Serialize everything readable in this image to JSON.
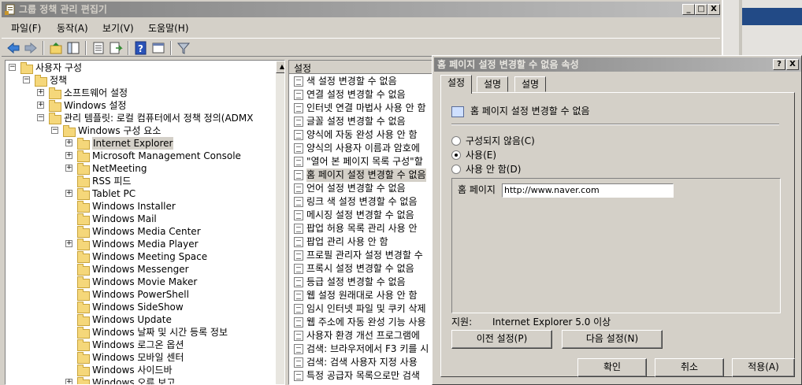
{
  "window": {
    "title": "그룹 정책 관리 편집기",
    "controls": {
      "minimize": "_",
      "maximize": "□",
      "close": "X"
    }
  },
  "menu": [
    "파일(F)",
    "동작(A)",
    "보기(V)",
    "도움말(H)"
  ],
  "toolbar": {
    "icons": [
      "back-icon",
      "forward-icon",
      "up-folder-icon",
      "show-hide-tree-icon",
      "export-list-icon",
      "properties-icon",
      "help-icon",
      "console-tree-icon",
      "filter-icon"
    ]
  },
  "tree": {
    "items": [
      {
        "label": "사용자 구성",
        "expander": "−",
        "depth": 0
      },
      {
        "label": "정책",
        "expander": "−",
        "depth": 1
      },
      {
        "label": "소프트웨어 설정",
        "expander": "+",
        "depth": 2
      },
      {
        "label": "Windows 설정",
        "expander": "+",
        "depth": 2
      },
      {
        "label": "관리 템플릿: 로컬 컴퓨터에서 정책 정의(ADMX",
        "expander": "−",
        "depth": 2
      },
      {
        "label": "Windows 구성 요소",
        "expander": "−",
        "depth": 3
      },
      {
        "label": "Internet Explorer",
        "expander": "+",
        "depth": 4,
        "selected": true
      },
      {
        "label": "Microsoft Management Console",
        "expander": "+",
        "depth": 4
      },
      {
        "label": "NetMeeting",
        "expander": "+",
        "depth": 4
      },
      {
        "label": "RSS 피드",
        "expander": "",
        "depth": 4
      },
      {
        "label": "Tablet PC",
        "expander": "+",
        "depth": 4
      },
      {
        "label": "Windows Installer",
        "expander": "",
        "depth": 4
      },
      {
        "label": "Windows Mail",
        "expander": "",
        "depth": 4
      },
      {
        "label": "Windows Media Center",
        "expander": "",
        "depth": 4
      },
      {
        "label": "Windows Media Player",
        "expander": "+",
        "depth": 4
      },
      {
        "label": "Windows Meeting Space",
        "expander": "",
        "depth": 4
      },
      {
        "label": "Windows Messenger",
        "expander": "",
        "depth": 4
      },
      {
        "label": "Windows Movie Maker",
        "expander": "",
        "depth": 4
      },
      {
        "label": "Windows PowerShell",
        "expander": "",
        "depth": 4
      },
      {
        "label": "Windows SideShow",
        "expander": "",
        "depth": 4
      },
      {
        "label": "Windows Update",
        "expander": "",
        "depth": 4
      },
      {
        "label": "Windows 날짜 및 시간 등록 정보",
        "expander": "",
        "depth": 4
      },
      {
        "label": "Windows 로그온 옵션",
        "expander": "",
        "depth": 4
      },
      {
        "label": "Windows 모바일 센터",
        "expander": "",
        "depth": 4
      },
      {
        "label": "Windows 사이드바",
        "expander": "",
        "depth": 4
      },
      {
        "label": "Windows 오류 보고",
        "expander": "+",
        "depth": 4
      }
    ]
  },
  "list": {
    "header": "설정",
    "items": [
      "색 설정 변경할 수 없음",
      "연결 설정 변경할 수 없음",
      "인터넷 연결 마법사 사용 안 함",
      "글꼴 설정 변경할 수 없음",
      "양식에 자동 완성 사용 안 함",
      "양식의 사용자 이름과 암호에",
      "\"열어 본 페이지 목록 구성\"할",
      "홈 페이지 설정 변경할 수 없음",
      "언어 설정 변경할 수 없음",
      "링크 색 설정 변경할 수 없음",
      "메시징 설정 변경할 수 없음",
      "팝업 허용 목록 관리 사용 안",
      "팝업 관리 사용 안 함",
      "프로필 관리자 설정 변경할 수",
      "프록시 설정 변경할 수 없음",
      "등급 설정 변경할 수 없음",
      "웹 설정 원래대로 사용 안 함",
      "임시 인터넷 파일 및 쿠키 삭제",
      "웹 주소에 자동 완성 기능 사용",
      "사용자 환경 개선 프로그램에",
      "검색: 브라우저에서 F3 키를 시",
      "검색: 검색 사용자 지정 사용",
      "특정 공급자 목록으로만 검색"
    ],
    "selected_index": 7
  },
  "dialog": {
    "title": "홈 페이지 설정 변경할 수 없음 속성",
    "controls": {
      "help": "?",
      "close": "X"
    },
    "tabs": [
      "설정",
      "설명",
      "설명"
    ],
    "setting_name": "홈 페이지 설정 변경할 수 없음",
    "radios": [
      {
        "label": "구성되지 않음(C)",
        "checked": false
      },
      {
        "label": "사용(E)",
        "checked": true
      },
      {
        "label": "사용 안 함(D)",
        "checked": false
      }
    ],
    "homepage_label": "홈 페이지",
    "homepage_value": "http://www.naver.com",
    "support_label": "지원:",
    "support_value": "Internet Explorer 5.0 이상",
    "prev_button": "이전 설정(P)",
    "next_button": "다음 설정(N)",
    "ok_button": "확인",
    "cancel_button": "취소",
    "apply_button": "적용(A)"
  }
}
